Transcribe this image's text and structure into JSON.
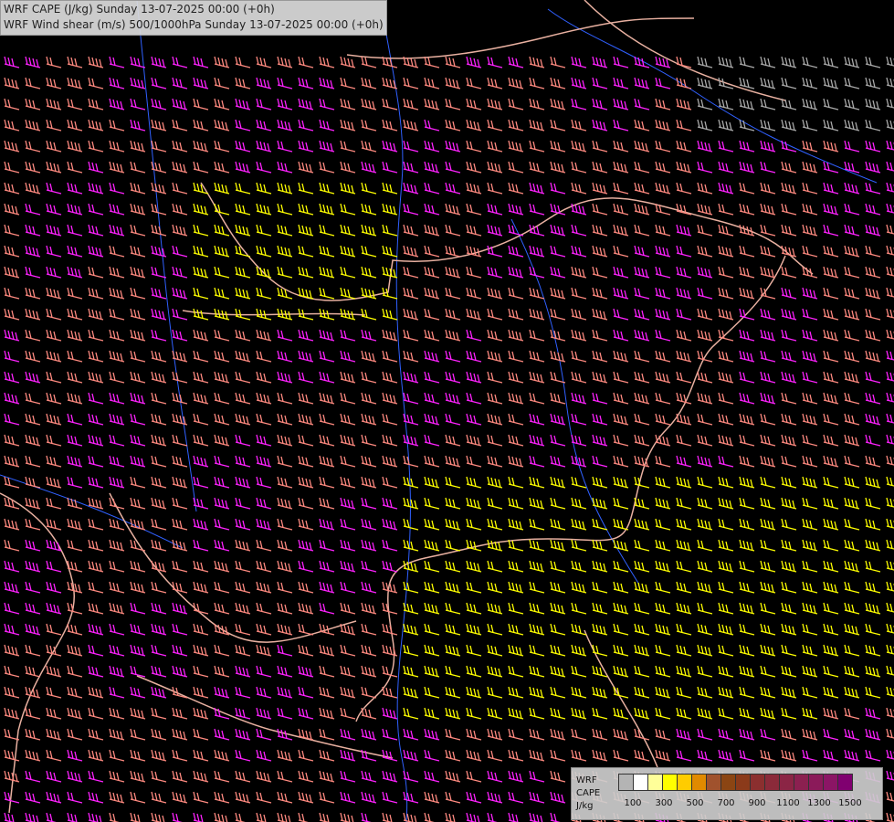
{
  "title": {
    "line1": "WRF CAPE (J/kg) Sunday 13-07-2025 00:00 (+0h)",
    "line2": "WRF Wind shear (m/s) 500/1000hPa Sunday 13-07-2025 00:00 (+0h)"
  },
  "legend": {
    "label1": "WRF",
    "label2": "CAPE",
    "label3": "J/kg",
    "swatches": [
      "#b4b4b4",
      "#ffffff",
      "#ffff99",
      "#ffff00",
      "#ffcc00",
      "#e08a00",
      "#a0522d",
      "#8b4513",
      "#8b3a1a",
      "#8b2f2f",
      "#8b2a3a",
      "#8b2545",
      "#8b2050",
      "#8b1a5a",
      "#8b1565",
      "#800070"
    ],
    "ticks": [
      "100",
      "300",
      "500",
      "700",
      "900",
      "1100",
      "1300",
      "1500"
    ]
  },
  "colors": {
    "background": "#000000",
    "barb_magenta": "#ff22ff",
    "barb_salmon": "#ff8a80",
    "barb_yellow": "#ffff00",
    "barb_grey": "#aaaaaa",
    "border": "#e8b0a0",
    "river": "#3060ff"
  }
}
